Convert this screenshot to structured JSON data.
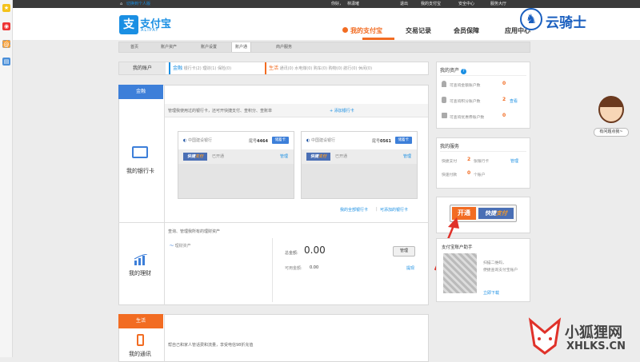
{
  "topbar": {
    "switch_personal": "切换到个人版",
    "greeting": "你好，",
    "username": "林潇璀",
    "logout": "退出",
    "my_alipay": "我的支付宝",
    "security_center": "安全中心",
    "service_hall": "服务大厅"
  },
  "logo": {
    "mark": "支",
    "cn": "支付宝",
    "en": "ALIPAY"
  },
  "nav": {
    "items": [
      "我的支付宝",
      "交易记录",
      "会员保障",
      "应用中心"
    ]
  },
  "subnav": {
    "items": [
      "首页",
      "账户资产",
      "账户设置",
      "账户通",
      "商户服务"
    ]
  },
  "acct_bar": {
    "label": "我的账户",
    "finance_title": "金融",
    "finance_items": "银行卡(2)   理财(1)   保险(0)",
    "life_title": "生活",
    "life_items": "通讯(0)   水电煤(0)   购车(0)   购物(0)   航行(0)   休闲(0)"
  },
  "finance": {
    "label": "金融",
    "bank_section_label": "我的银行卡",
    "bank_desc": "管理我使用过的银行卡，还可开快捷支付、查积分、查账单",
    "add_bank": "+ 添加银行卡",
    "cards": [
      {
        "bank": "中国建设银行",
        "tail_label": "尾号",
        "tail": "4464",
        "type": "储蓄卡",
        "quick_a": "快捷",
        "quick_b": "支付",
        "status": "已开通",
        "manage": "管理"
      },
      {
        "bank": "中国建设银行",
        "tail_label": "尾号",
        "tail": "0561",
        "type": "储蓄卡",
        "quick_a": "快捷",
        "quick_b": "支付",
        "status": "已开通",
        "manage": "管理"
      }
    ],
    "all_cards_link": "我的全部银行卡",
    "sep": "|",
    "addable_link": "可添加的银行卡",
    "wealth_label": "我的理财",
    "wealth_desc": "查询、管理我所有的理财资产",
    "wealth_asset": "理财资产",
    "total_label": "总金额:",
    "total_value": "0.00",
    "available_label": "可用金额:",
    "available_value": "0.00",
    "manage_btn": "管理",
    "cash_link": "提现"
  },
  "life": {
    "label": "生活",
    "phone_label": "我的通讯",
    "phone_desc": "帮自己和家人管话费和流量，享受电信98折充值"
  },
  "assets": {
    "title": "我的资产",
    "help": "?",
    "rows": [
      {
        "label": "可查询金额账户数",
        "count": "0",
        "link": ""
      },
      {
        "label": "可查询积分账户数",
        "count": "2",
        "link": "查看"
      },
      {
        "label": "可查询优惠券账户数",
        "count": "0",
        "link": ""
      }
    ]
  },
  "services": {
    "title": "我的服务",
    "rows": [
      {
        "label": "快捷支付",
        "count": "2",
        "unit": "张银行卡",
        "link": "管理"
      },
      {
        "label": "快速付款",
        "count": "0",
        "unit": "个账户",
        "link": ""
      }
    ]
  },
  "promo": {
    "open": "开通",
    "quick_a": "快捷",
    "quick_b": "支付"
  },
  "qr": {
    "title": "支付宝账户助手",
    "line1": "扫描二维码，",
    "line2": "便捷查询支付宝账户",
    "download": "立即下载"
  },
  "helper": {
    "bubble": "有问题点我~"
  },
  "watermarks": {
    "top_right": "云骑士",
    "bottom_right_cn": "小狐狸网",
    "bottom_right_en": "XHLKS.CN"
  },
  "colors": {
    "brand": "#1a8fe3",
    "accent": "#f26c22",
    "arrow": "#e0322a"
  }
}
